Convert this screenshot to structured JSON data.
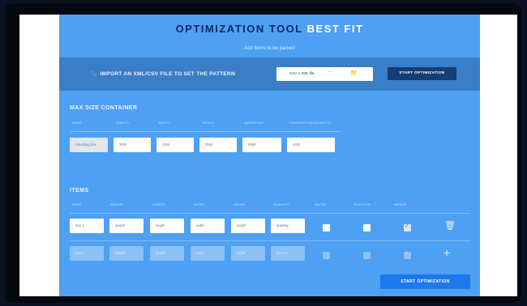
{
  "header": {
    "title_main": "OPTIMIZATION TOOL",
    "title_accent": "BEST FIT",
    "subtitle": "Add items to be packed"
  },
  "import": {
    "icon": "paperclip-icon",
    "label": "IMPORT AN XML/CSV FILE TO SET THE PATTERN",
    "file_value": "CSV o XML file",
    "file_dots": "···",
    "folder_icon": "folder-icon",
    "start_label": "START OPTIMIZATION"
  },
  "container": {
    "title": "MAX SIZE CONTAINER",
    "headers": [
      "NAME",
      "LENGTH",
      "WIDTH",
      "HEIGTH",
      "MAXWEIGHT",
      "CONTAINER MAXQUANTITY"
    ],
    "values": [
      "Sounding box",
      "3000",
      "2000",
      "3000",
      "9999",
      "1000"
    ]
  },
  "items": {
    "title": "ITEMS",
    "headers": [
      "NAME",
      "WEIGHT",
      "LENGTH",
      "WIDTH",
      "HEIGHT",
      "QUANTITY",
      "ON TOP",
      "ROTATION",
      "REPACK"
    ],
    "rows": [
      {
        "values": [
          "Box 1",
          "weight",
          "length",
          "width",
          "height",
          "quantity"
        ],
        "on_top": false,
        "rotation": false,
        "repack": true,
        "action_icon": "trash-icon"
      },
      {
        "values": [
          "box 1",
          "weight",
          "length",
          "width",
          "height",
          "quantity"
        ],
        "on_top": false,
        "rotation": false,
        "repack": true,
        "action_icon": "plus-icon"
      }
    ],
    "start_label": "START OPTIMIZATION"
  },
  "colors": {
    "panel": "#4ea0f3",
    "import_band": "#3a7ec8",
    "dark_button": "#143e74",
    "primary_button": "#1d79ee",
    "title_dark": "#0a2a66"
  }
}
